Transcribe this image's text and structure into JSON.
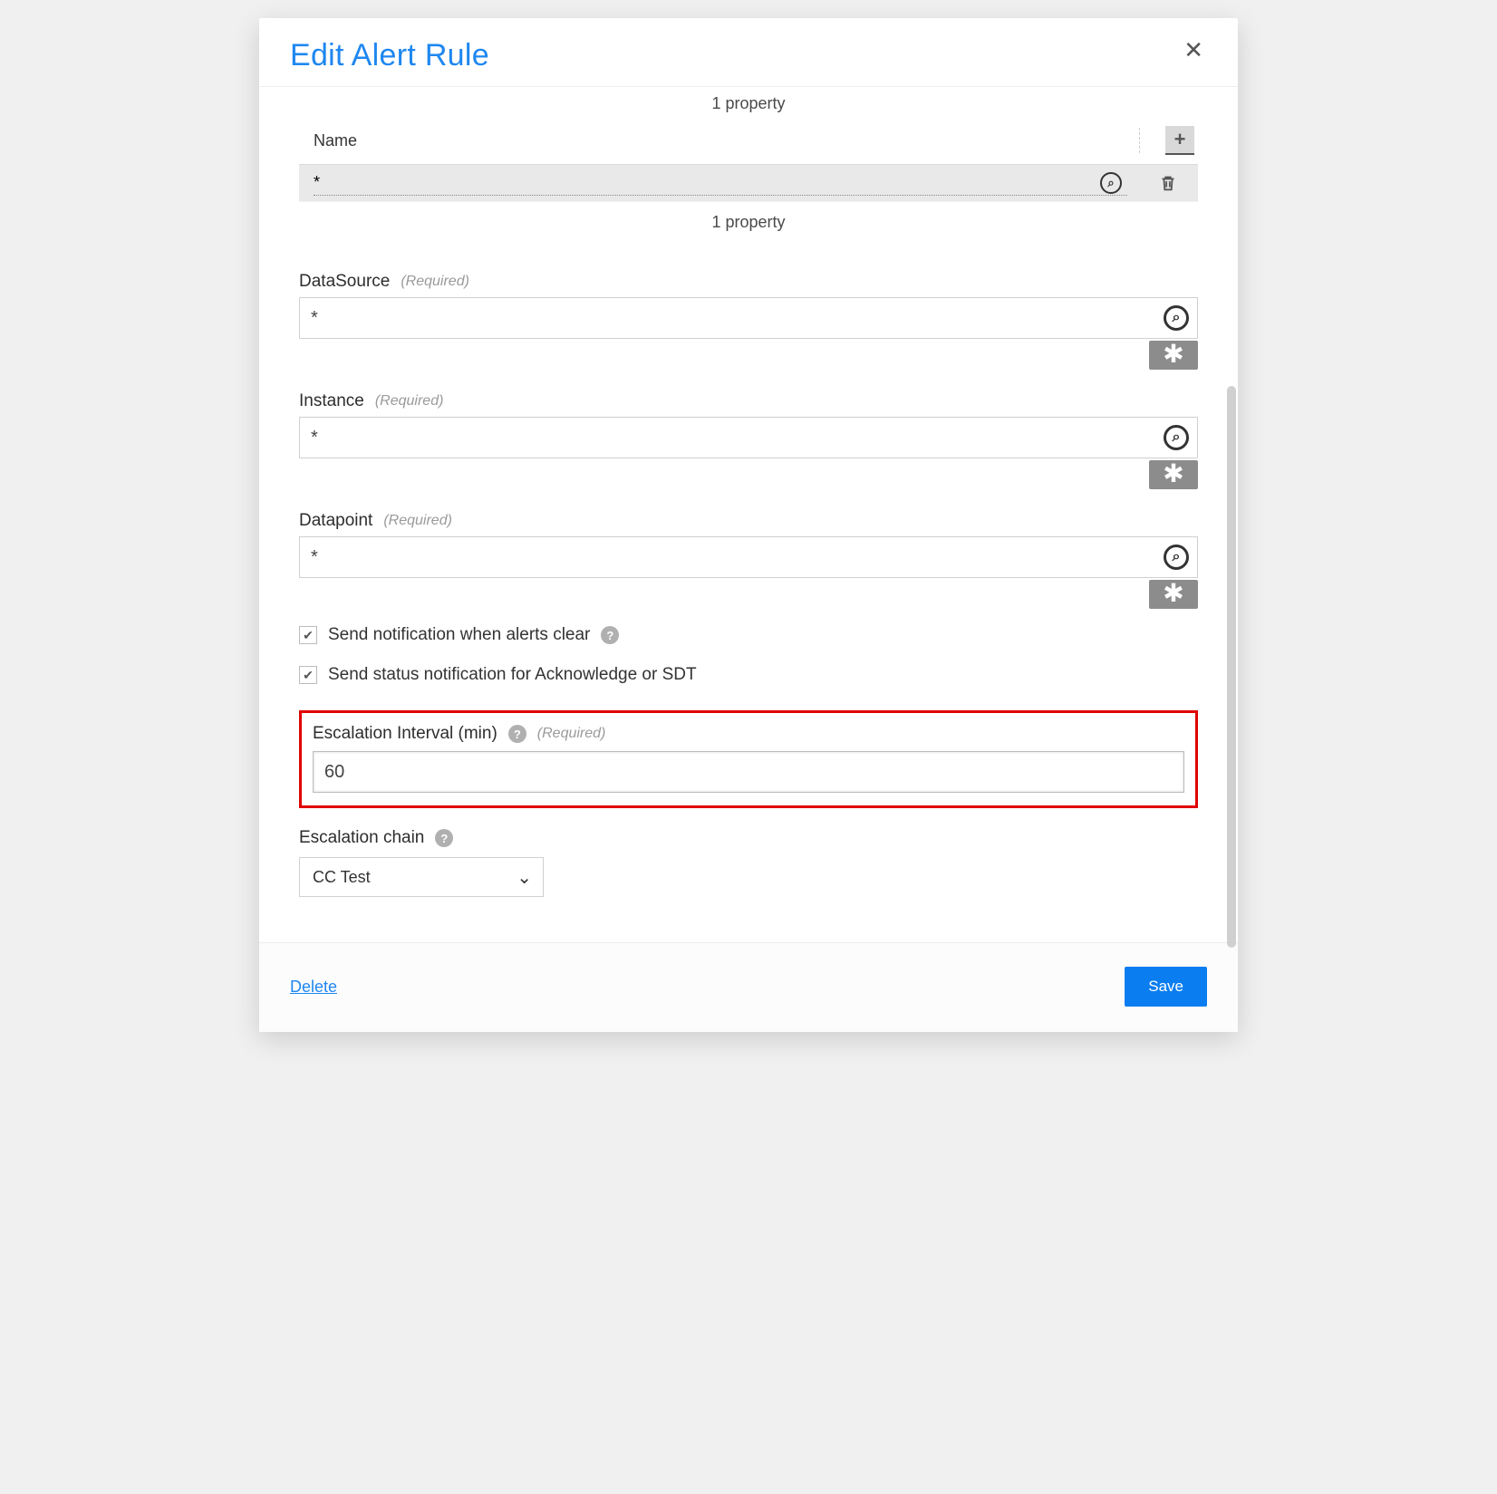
{
  "dialog": {
    "title": "Edit Alert Rule",
    "close_icon": "✕"
  },
  "property_group": {
    "top_summary": "1 property",
    "name_header": "Name",
    "row_value": "*",
    "bottom_summary": "1 property"
  },
  "fields": {
    "datasource": {
      "label": "DataSource",
      "required": "(Required)",
      "value": "*"
    },
    "instance": {
      "label": "Instance",
      "required": "(Required)",
      "value": "*"
    },
    "datapoint": {
      "label": "Datapoint",
      "required": "(Required)",
      "value": "*"
    }
  },
  "checkboxes": {
    "clear": {
      "label": "Send notification when alerts clear",
      "checked": true
    },
    "ack": {
      "label": "Send status notification for Acknowledge or SDT",
      "checked": true
    },
    "tick": "✔"
  },
  "escalation_interval": {
    "label": "Escalation Interval (min)",
    "required": "(Required)",
    "value": "60"
  },
  "escalation_chain": {
    "label": "Escalation chain",
    "selected": "CC Test"
  },
  "footer": {
    "delete_label": "Delete",
    "save_label": "Save"
  },
  "icons": {
    "search_glyph": "⌕",
    "star": "✱",
    "plus": "+",
    "help": "?",
    "chevron": "⌄"
  }
}
